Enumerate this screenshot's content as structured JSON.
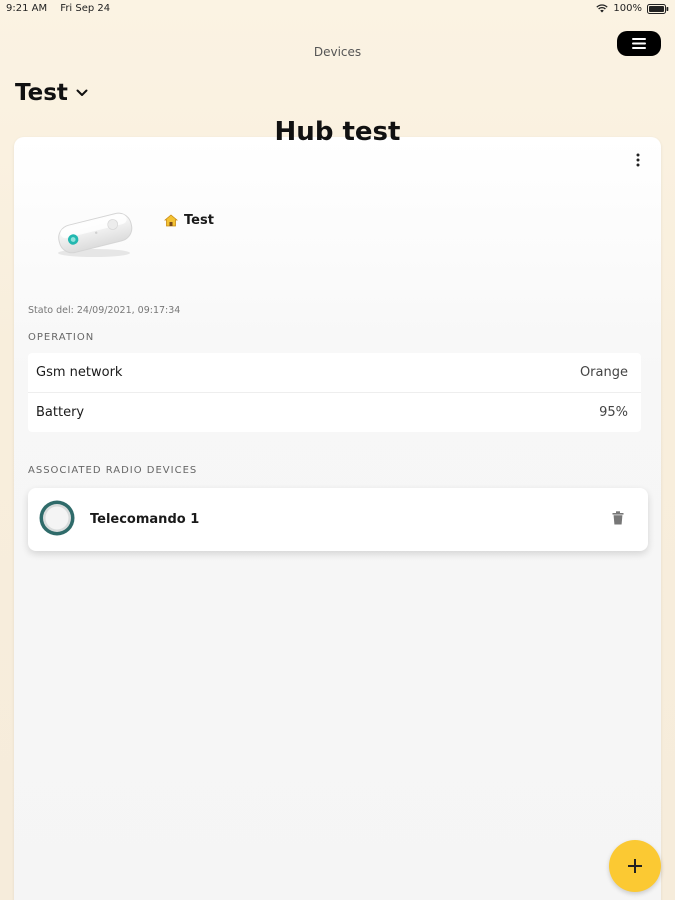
{
  "status_bar": {
    "time": "9:21 AM",
    "date": "Fri Sep 24",
    "battery": "100%"
  },
  "nav": {
    "title": "Devices",
    "menu_icon": "hamburger-icon"
  },
  "location": {
    "name": "Test",
    "dropdown_icon": "chevron-down-icon"
  },
  "hub": {
    "title": "Hub test",
    "device_name": "Test",
    "device_icon": "house-icon",
    "status_date": "Stato del: 24/09/2021, 09:17:34",
    "more_icon": "more-vertical-icon"
  },
  "operation": {
    "title": "OPERATION",
    "rows": [
      {
        "label": "Gsm network",
        "value": "Orange"
      },
      {
        "label": "Battery",
        "value": "95%"
      }
    ]
  },
  "radio_devices": {
    "title": "ASSOCIATED RADIO DEVICES",
    "items": [
      {
        "name": "Telecomando 1",
        "icon": "remote-control-icon",
        "action_icon": "trash-icon"
      }
    ]
  },
  "fab": {
    "label": "+",
    "icon": "plus-icon"
  },
  "colors": {
    "accent": "#fbc933",
    "background": "#fbf3e3",
    "card": "#ffffff"
  }
}
